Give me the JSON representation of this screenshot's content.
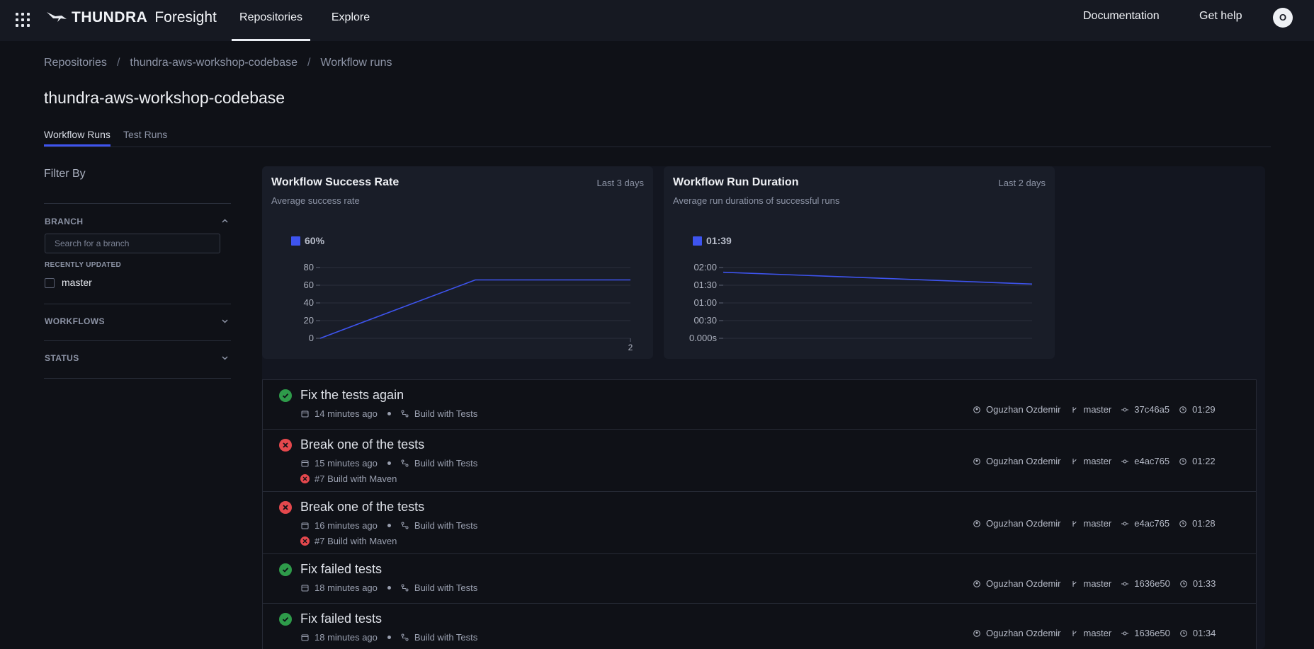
{
  "nav": {
    "brand": "THUNDRA",
    "product": "Foresight",
    "tabs": [
      "Repositories",
      "Explore"
    ],
    "links": [
      "Documentation",
      "Get help"
    ],
    "avatar": "O"
  },
  "breadcrumb": [
    "Repositories",
    "thundra-aws-workshop-codebase",
    "Workflow runs"
  ],
  "page_title": "thundra-aws-workshop-codebase",
  "tabs": [
    "Workflow Runs",
    "Test Runs"
  ],
  "sidebar": {
    "title": "Filter By",
    "sections": [
      "BRANCH",
      "WORKFLOWS",
      "STATUS"
    ],
    "search_placeholder": "Search for a branch",
    "recent_label": "RECENTLY UPDATED",
    "branches": [
      "master"
    ]
  },
  "accent": "#3e54ef",
  "chart_data": [
    {
      "type": "line",
      "title": "Workflow Success Rate",
      "range_label": "Last 3 days",
      "subtitle": "Average success rate",
      "legend": "60%",
      "x": [
        0,
        1,
        2
      ],
      "x_tick_labels": [
        "2"
      ],
      "values": [
        0,
        66,
        66
      ],
      "yticks": [
        "0",
        "20",
        "40",
        "60",
        "80"
      ],
      "ylim": [
        0,
        80
      ]
    },
    {
      "type": "line",
      "title": "Workflow Run Duration",
      "range_label": "Last 2 days",
      "subtitle": "Average run durations of successful runs",
      "legend": "01:39",
      "x": [
        0,
        1
      ],
      "values_seconds": [
        112,
        92
      ],
      "yticks": [
        "0.000s",
        "00:30",
        "01:00",
        "01:30",
        "02:00"
      ],
      "ylim": [
        0,
        120
      ]
    }
  ],
  "runs": [
    {
      "title": "Fix the tests again",
      "status": "success",
      "time": "14 minutes ago",
      "workflow": "Build with Tests",
      "job": "",
      "author": "Oguzhan Ozdemir",
      "branch": "master",
      "commit": "37c46a5",
      "duration": "01:29"
    },
    {
      "title": "Break one of the tests",
      "status": "failure",
      "time": "15 minutes ago",
      "workflow": "Build with Tests",
      "job": "#7 Build with Maven",
      "author": "Oguzhan Ozdemir",
      "branch": "master",
      "commit": "e4ac765",
      "duration": "01:22"
    },
    {
      "title": "Break one of the tests",
      "status": "failure",
      "time": "16 minutes ago",
      "workflow": "Build with Tests",
      "job": "#7 Build with Maven",
      "author": "Oguzhan Ozdemir",
      "branch": "master",
      "commit": "e4ac765",
      "duration": "01:28"
    },
    {
      "title": "Fix failed tests",
      "status": "success",
      "time": "18 minutes ago",
      "workflow": "Build with Tests",
      "job": "",
      "author": "Oguzhan Ozdemir",
      "branch": "master",
      "commit": "1636e50",
      "duration": "01:33"
    },
    {
      "title": "Fix failed tests",
      "status": "success",
      "time": "18 minutes ago",
      "workflow": "Build with Tests",
      "job": "",
      "author": "Oguzhan Ozdemir",
      "branch": "master",
      "commit": "1636e50",
      "duration": "01:34"
    }
  ]
}
